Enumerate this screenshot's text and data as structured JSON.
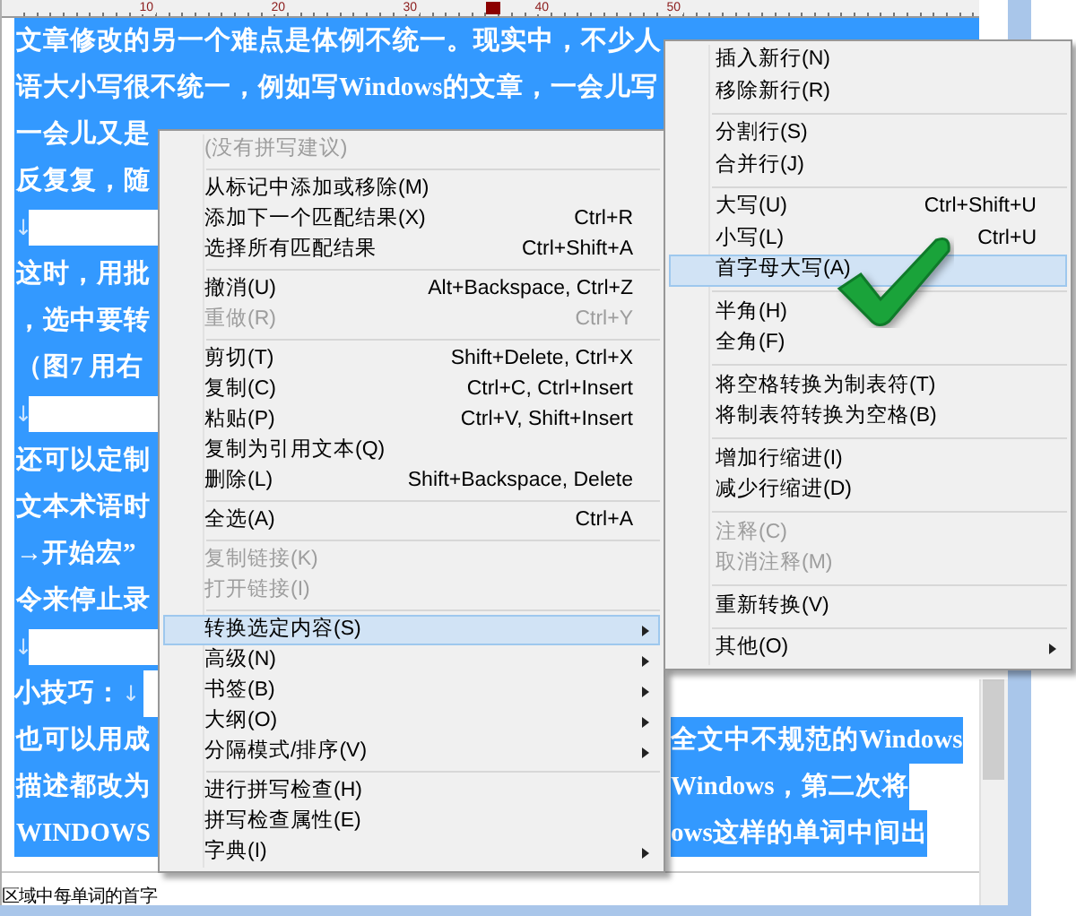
{
  "ruler": {
    "labels": [
      "10",
      "20",
      "30",
      "40",
      "50"
    ]
  },
  "document": {
    "lines": [
      {
        "kind": "text",
        "text": "文章修改的另一个难点是体例不统一。现实中，不少人"
      },
      {
        "kind": "text",
        "text": "语大小写很不统一，例如写Windows的文章，一会儿写"
      },
      {
        "kind": "text",
        "text": "一会儿又是"
      },
      {
        "kind": "text",
        "text": "反复复，随"
      },
      {
        "kind": "blank",
        "mark": "↓"
      },
      {
        "kind": "text",
        "text": "这时，用批"
      },
      {
        "kind": "text",
        "text": "，选中要转"
      },
      {
        "kind": "text",
        "text": "（图7 用右"
      },
      {
        "kind": "blank",
        "mark": "↓"
      },
      {
        "kind": "text",
        "text": "还可以定制"
      },
      {
        "kind": "text",
        "text": "文本术语时"
      },
      {
        "kind": "text",
        "text": "→开始宏”"
      },
      {
        "kind": "text",
        "text": "令来停止录"
      },
      {
        "kind": "blank",
        "mark": "↓"
      },
      {
        "kind": "line_end",
        "text": "小技巧：",
        "mark": "↓"
      },
      {
        "kind": "split",
        "left": "也可以用成",
        "right": "全文中不规范的Windows"
      },
      {
        "kind": "split",
        "left": "描述都改为",
        "right": "Windows，第二次将"
      },
      {
        "kind": "split",
        "left": "WINDOWS",
        "right": "ows这样的单词中间出"
      }
    ]
  },
  "status_bar": {
    "text": "区域中每单词的首字"
  },
  "context_menu": {
    "items": [
      {
        "kind": "item",
        "label": "(没有拼写建议)",
        "disabled": true,
        "selected": false,
        "submenu": false
      },
      {
        "kind": "separator"
      },
      {
        "kind": "item",
        "label": "从标记中添加或移除(M)",
        "disabled": false,
        "selected": false,
        "submenu": false
      },
      {
        "kind": "item",
        "label": "添加下一个匹配结果(X)",
        "shortcut": "Ctrl+R",
        "disabled": false,
        "selected": false,
        "submenu": false
      },
      {
        "kind": "item",
        "label": "选择所有匹配结果",
        "shortcut": "Ctrl+Shift+A",
        "disabled": false,
        "selected": false,
        "submenu": false
      },
      {
        "kind": "separator"
      },
      {
        "kind": "item",
        "label": "撤消(U)",
        "shortcut": "Alt+Backspace, Ctrl+Z",
        "disabled": false,
        "selected": false,
        "submenu": false
      },
      {
        "kind": "item",
        "label": "重做(R)",
        "shortcut": "Ctrl+Y",
        "disabled": true,
        "selected": false,
        "submenu": false
      },
      {
        "kind": "separator"
      },
      {
        "kind": "item",
        "label": "剪切(T)",
        "shortcut": "Shift+Delete, Ctrl+X",
        "disabled": false,
        "selected": false,
        "submenu": false
      },
      {
        "kind": "item",
        "label": "复制(C)",
        "shortcut": "Ctrl+C, Ctrl+Insert",
        "disabled": false,
        "selected": false,
        "submenu": false
      },
      {
        "kind": "item",
        "label": "粘贴(P)",
        "shortcut": "Ctrl+V, Shift+Insert",
        "disabled": false,
        "selected": false,
        "submenu": false
      },
      {
        "kind": "item",
        "label": "复制为引用文本(Q)",
        "disabled": false,
        "selected": false,
        "submenu": false
      },
      {
        "kind": "item",
        "label": "删除(L)",
        "shortcut": "Shift+Backspace, Delete",
        "disabled": false,
        "selected": false,
        "submenu": false
      },
      {
        "kind": "separator"
      },
      {
        "kind": "item",
        "label": "全选(A)",
        "shortcut": "Ctrl+A",
        "disabled": false,
        "selected": false,
        "submenu": false
      },
      {
        "kind": "separator"
      },
      {
        "kind": "item",
        "label": "复制链接(K)",
        "disabled": true,
        "selected": false,
        "submenu": false
      },
      {
        "kind": "item",
        "label": "打开链接(I)",
        "disabled": true,
        "selected": false,
        "submenu": false
      },
      {
        "kind": "separator"
      },
      {
        "kind": "item",
        "label": "转换选定内容(S)",
        "disabled": false,
        "selected": true,
        "submenu": true
      },
      {
        "kind": "item",
        "label": "高级(N)",
        "disabled": false,
        "selected": false,
        "submenu": true
      },
      {
        "kind": "item",
        "label": "书签(B)",
        "disabled": false,
        "selected": false,
        "submenu": true
      },
      {
        "kind": "item",
        "label": "大纲(O)",
        "disabled": false,
        "selected": false,
        "submenu": true
      },
      {
        "kind": "item",
        "label": "分隔模式/排序(V)",
        "disabled": false,
        "selected": false,
        "submenu": true
      },
      {
        "kind": "separator"
      },
      {
        "kind": "item",
        "label": "进行拼写检查(H)",
        "disabled": false,
        "selected": false,
        "submenu": false
      },
      {
        "kind": "item",
        "label": "拼写检查属性(E)",
        "disabled": false,
        "selected": false,
        "submenu": false
      },
      {
        "kind": "item",
        "label": "字典(I)",
        "disabled": false,
        "selected": false,
        "submenu": true
      }
    ]
  },
  "submenu": {
    "items": [
      {
        "kind": "item",
        "label": "插入新行(N)",
        "disabled": false,
        "selected": false,
        "submenu": false
      },
      {
        "kind": "item",
        "label": "移除新行(R)",
        "disabled": false,
        "selected": false,
        "submenu": false
      },
      {
        "kind": "separator"
      },
      {
        "kind": "item",
        "label": "分割行(S)",
        "disabled": false,
        "selected": false,
        "submenu": false
      },
      {
        "kind": "item",
        "label": "合并行(J)",
        "disabled": false,
        "selected": false,
        "submenu": false
      },
      {
        "kind": "separator"
      },
      {
        "kind": "item",
        "label": "大写(U)",
        "shortcut": "Ctrl+Shift+U",
        "disabled": false,
        "selected": false,
        "submenu": false
      },
      {
        "kind": "item",
        "label": "小写(L)",
        "shortcut": "Ctrl+U",
        "disabled": false,
        "selected": false,
        "submenu": false
      },
      {
        "kind": "item",
        "label": "首字母大写(A)",
        "disabled": false,
        "selected": true,
        "submenu": false
      },
      {
        "kind": "separator"
      },
      {
        "kind": "item",
        "label": "半角(H)",
        "disabled": false,
        "selected": false,
        "submenu": false
      },
      {
        "kind": "item",
        "label": "全角(F)",
        "disabled": false,
        "selected": false,
        "submenu": false
      },
      {
        "kind": "separator"
      },
      {
        "kind": "item",
        "label": "将空格转换为制表符(T)",
        "disabled": false,
        "selected": false,
        "submenu": false
      },
      {
        "kind": "item",
        "label": "将制表符转换为空格(B)",
        "disabled": false,
        "selected": false,
        "submenu": false
      },
      {
        "kind": "separator"
      },
      {
        "kind": "item",
        "label": "增加行缩进(I)",
        "disabled": false,
        "selected": false,
        "submenu": false
      },
      {
        "kind": "item",
        "label": "减少行缩进(D)",
        "disabled": false,
        "selected": false,
        "submenu": false
      },
      {
        "kind": "separator"
      },
      {
        "kind": "item",
        "label": "注释(C)",
        "disabled": true,
        "selected": false,
        "submenu": false
      },
      {
        "kind": "item",
        "label": "取消注释(M)",
        "disabled": true,
        "selected": false,
        "submenu": false
      },
      {
        "kind": "separator"
      },
      {
        "kind": "item",
        "label": "重新转换(V)",
        "disabled": false,
        "selected": false,
        "submenu": false
      },
      {
        "kind": "separator"
      },
      {
        "kind": "item",
        "label": "其他(O)",
        "disabled": false,
        "selected": false,
        "submenu": true
      }
    ]
  }
}
